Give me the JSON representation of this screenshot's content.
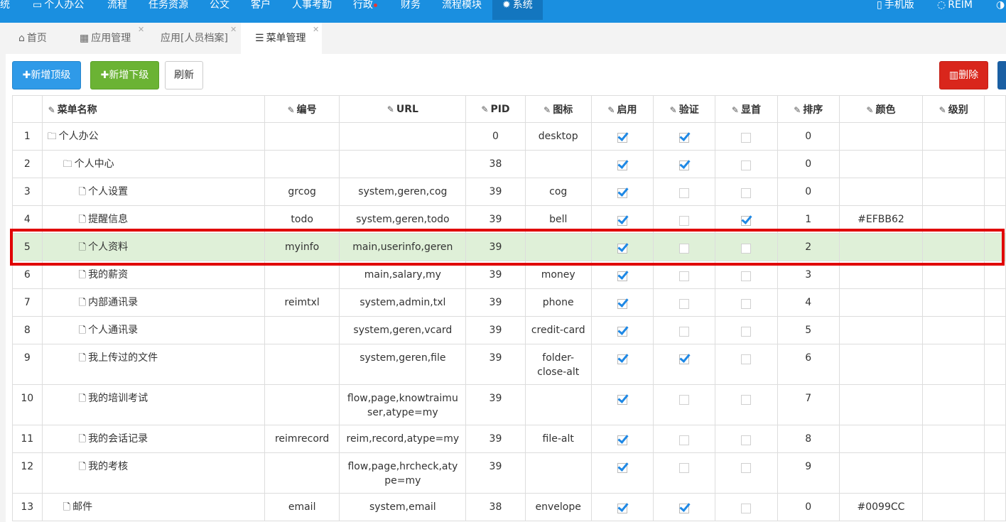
{
  "topnav": {
    "items": [
      {
        "label": "统"
      },
      {
        "label": "个人办公"
      },
      {
        "label": "流程"
      },
      {
        "label": "任务资源"
      },
      {
        "label": "公文"
      },
      {
        "label": "客户"
      },
      {
        "label": "人事考勤"
      },
      {
        "label": "行政"
      },
      {
        "label": "财务"
      },
      {
        "label": "流程模块"
      },
      {
        "label": "系统"
      }
    ],
    "right": [
      {
        "label": "手机版"
      },
      {
        "label": "REIM"
      }
    ]
  },
  "tabs": [
    {
      "label": "首页"
    },
    {
      "label": "应用管理"
    },
    {
      "label": "应用[人员档案]"
    },
    {
      "label": "菜单管理"
    }
  ],
  "toolbar": {
    "add_top": "新增顶级",
    "add_child": "新增下级",
    "refresh": "刷新",
    "delete": "删除"
  },
  "columns": [
    "菜单名称",
    "编号",
    "URL",
    "PID",
    "图标",
    "启用",
    "验证",
    "显首",
    "排序",
    "颜色",
    "级别"
  ],
  "rows": [
    {
      "n": "1",
      "name": "个人办公",
      "type": "folder",
      "indent": 0,
      "code": "",
      "url": "",
      "pid": "0",
      "icon": "desktop",
      "en": true,
      "ver": true,
      "home": false,
      "sort": "0",
      "color": ""
    },
    {
      "n": "2",
      "name": "个人中心",
      "type": "folder",
      "indent": 1,
      "code": "",
      "url": "",
      "pid": "38",
      "icon": "",
      "en": true,
      "ver": true,
      "home": false,
      "sort": "0",
      "color": ""
    },
    {
      "n": "3",
      "name": "个人设置",
      "type": "file",
      "indent": 2,
      "code": "grcog",
      "url": "system,geren,cog",
      "pid": "39",
      "icon": "cog",
      "en": true,
      "ver": false,
      "home": false,
      "sort": "0",
      "color": ""
    },
    {
      "n": "4",
      "name": "提醒信息",
      "type": "file",
      "indent": 2,
      "code": "todo",
      "url": "system,geren,todo",
      "pid": "39",
      "icon": "bell",
      "en": true,
      "ver": false,
      "home": true,
      "sort": "1",
      "color": "#EFBB62"
    },
    {
      "n": "5",
      "name": "个人资料",
      "type": "file",
      "indent": 2,
      "code": "myinfo",
      "url": "main,userinfo,geren",
      "pid": "39",
      "icon": "",
      "en": true,
      "ver": false,
      "home": false,
      "sort": "2",
      "color": ""
    },
    {
      "n": "6",
      "name": "我的薪资",
      "type": "file",
      "indent": 2,
      "code": "",
      "url": "main,salary,my",
      "pid": "39",
      "icon": "money",
      "en": true,
      "ver": false,
      "home": false,
      "sort": "3",
      "color": ""
    },
    {
      "n": "7",
      "name": "内部通讯录",
      "type": "file",
      "indent": 2,
      "code": "reimtxl",
      "url": "system,admin,txl",
      "pid": "39",
      "icon": "phone",
      "en": true,
      "ver": false,
      "home": false,
      "sort": "4",
      "color": ""
    },
    {
      "n": "8",
      "name": "个人通讯录",
      "type": "file",
      "indent": 2,
      "code": "",
      "url": "system,geren,vcard",
      "pid": "39",
      "icon": "credit-card",
      "en": true,
      "ver": false,
      "home": false,
      "sort": "5",
      "color": ""
    },
    {
      "n": "9",
      "name": "我上传过的文件",
      "type": "file",
      "indent": 2,
      "code": "",
      "url": "system,geren,file",
      "pid": "39",
      "icon": "folder-close-alt",
      "en": true,
      "ver": true,
      "home": false,
      "sort": "6",
      "color": ""
    },
    {
      "n": "10",
      "name": "我的培训考试",
      "type": "file",
      "indent": 2,
      "code": "",
      "url": "flow,page,knowtraimuser,atype=my",
      "pid": "39",
      "icon": "",
      "en": true,
      "ver": false,
      "home": false,
      "sort": "7",
      "color": ""
    },
    {
      "n": "11",
      "name": "我的会话记录",
      "type": "file",
      "indent": 2,
      "code": "reimrecord",
      "url": "reim,record,atype=my",
      "pid": "39",
      "icon": "file-alt",
      "en": true,
      "ver": false,
      "home": false,
      "sort": "8",
      "color": ""
    },
    {
      "n": "12",
      "name": "我的考核",
      "type": "file",
      "indent": 2,
      "code": "",
      "url": "flow,page,hrcheck,atype=my",
      "pid": "39",
      "icon": "",
      "en": true,
      "ver": false,
      "home": false,
      "sort": "9",
      "color": ""
    },
    {
      "n": "13",
      "name": "邮件",
      "type": "file",
      "indent": 1,
      "code": "email",
      "url": "system,email",
      "pid": "38",
      "icon": "envelope",
      "en": true,
      "ver": true,
      "home": false,
      "sort": "0",
      "color": "#0099CC"
    }
  ],
  "selected_row": "5"
}
